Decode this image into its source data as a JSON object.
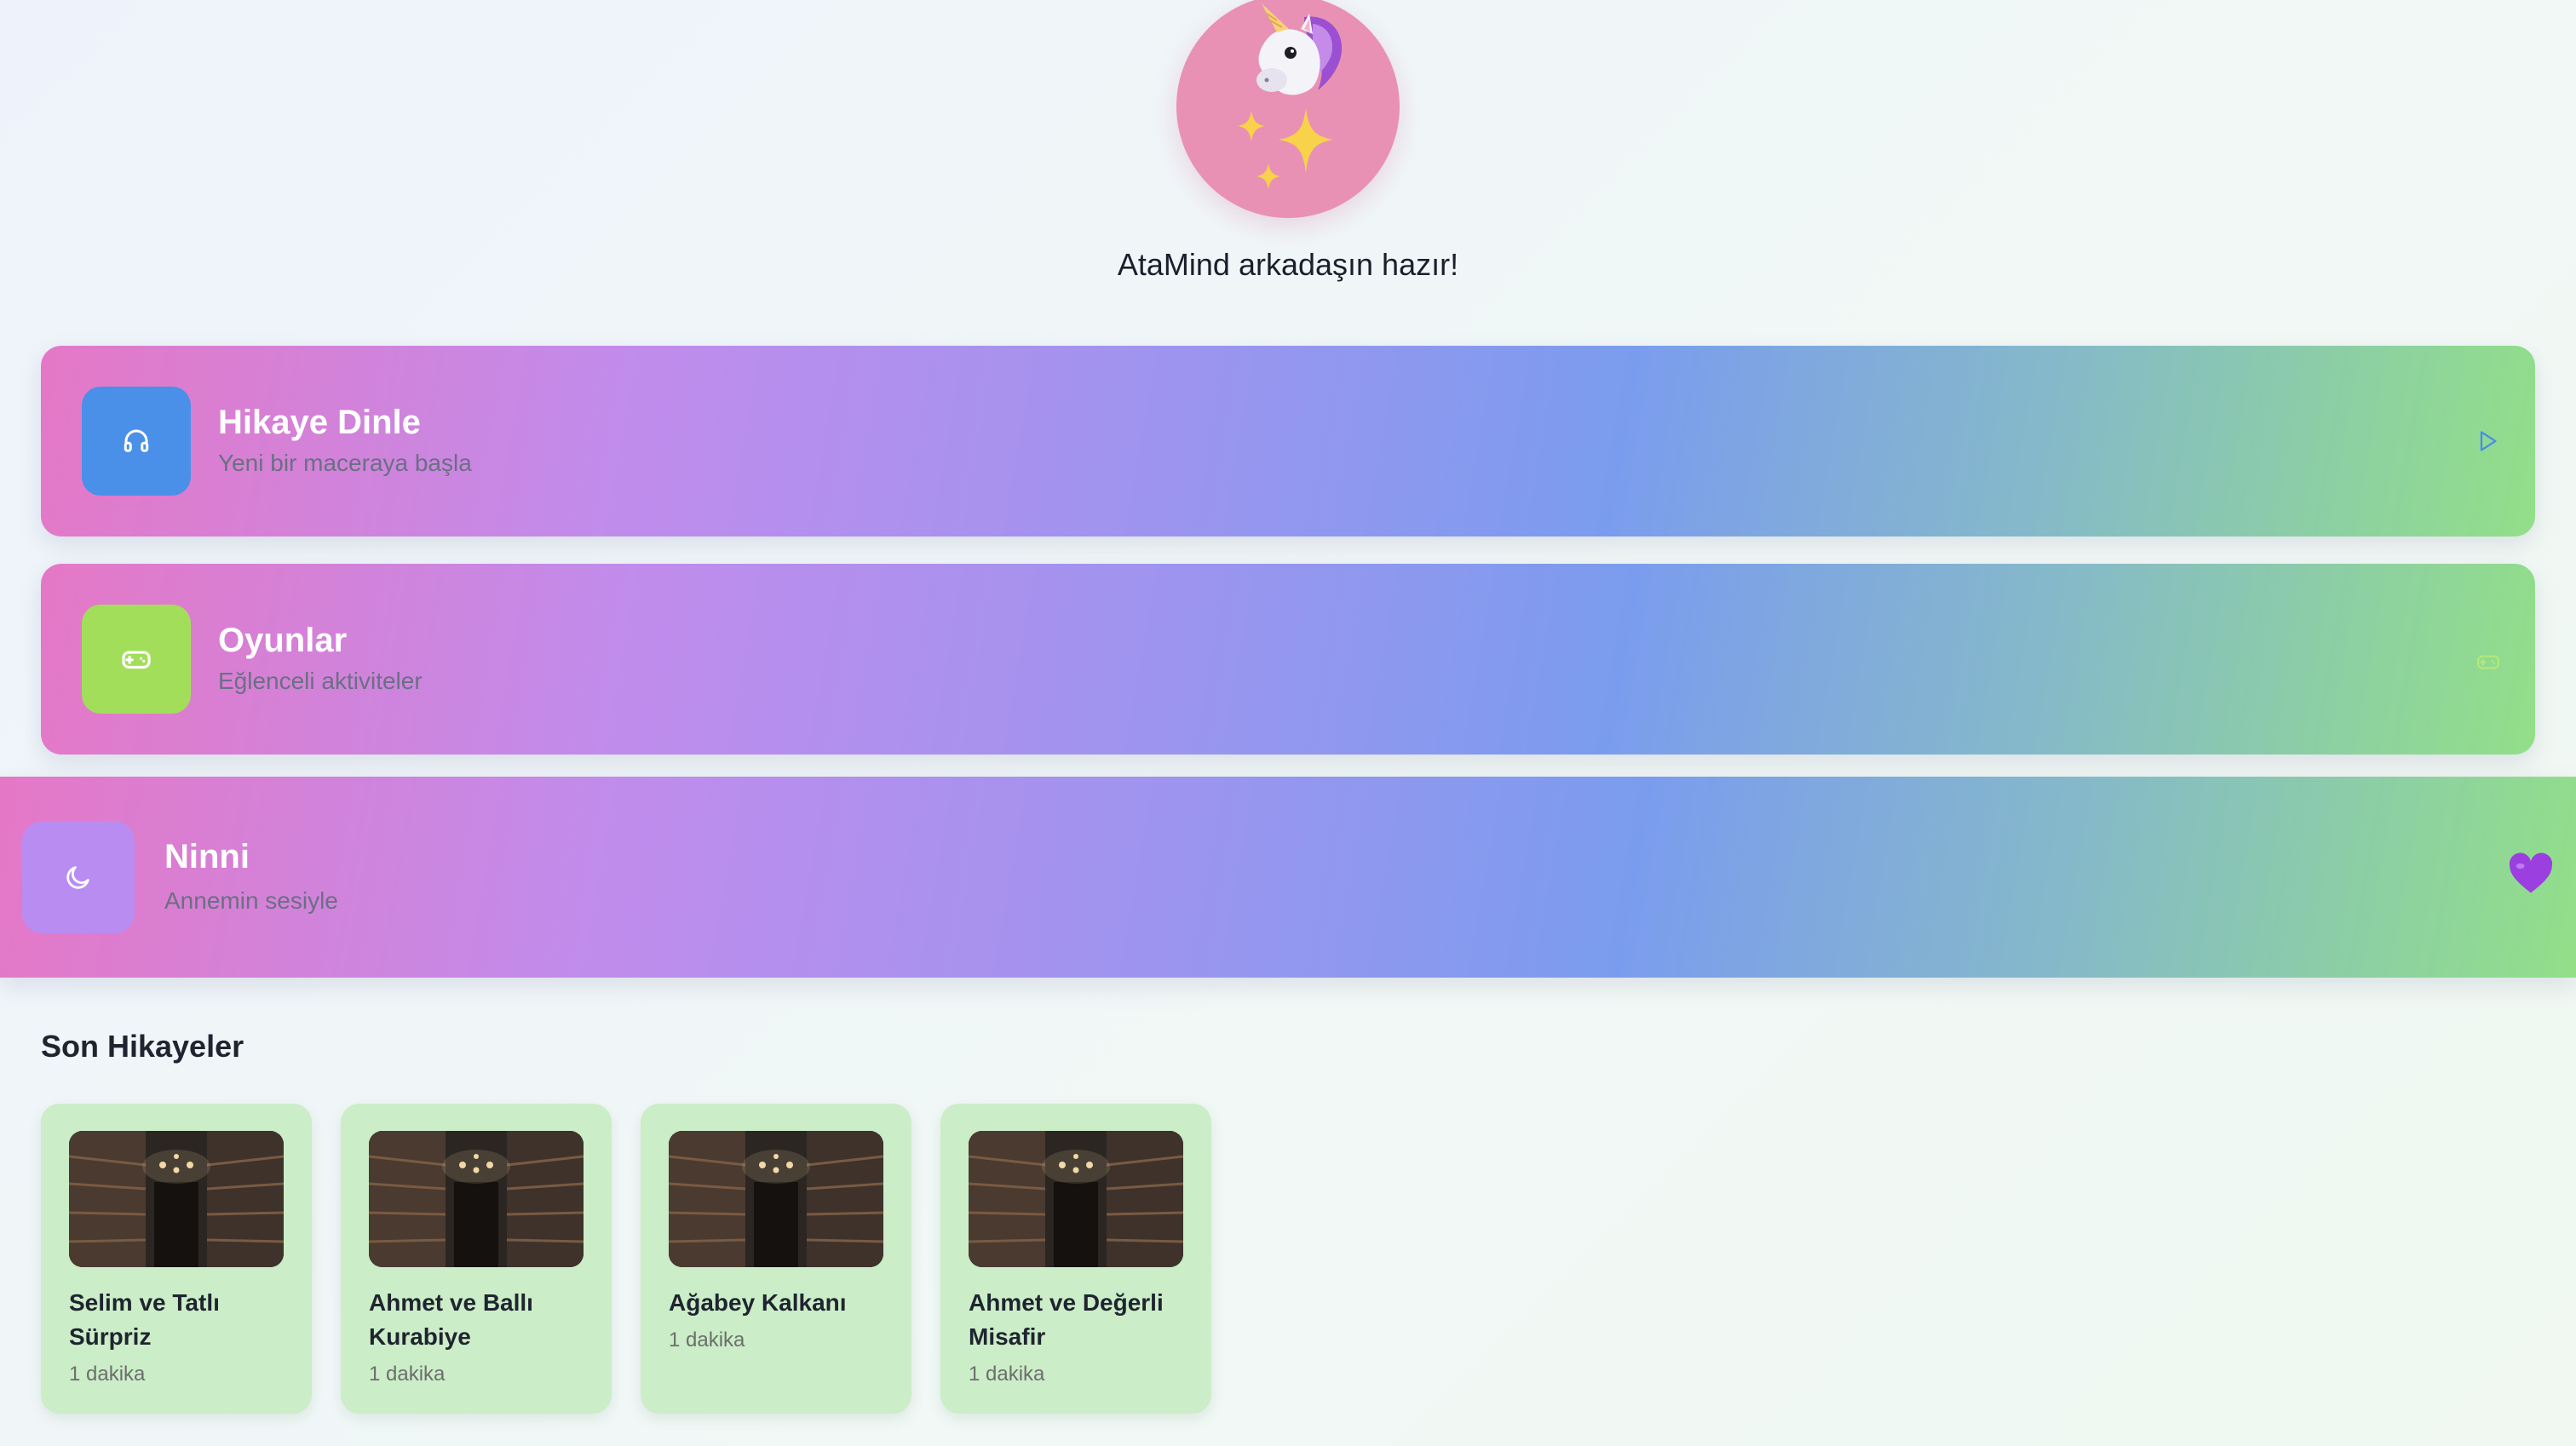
{
  "header": {
    "greeting": "AtaMind arkadaşın hazır!",
    "avatar_icon": "unicorn-sparkles"
  },
  "actions": [
    {
      "title": "Hikaye Dinle",
      "subtitle": "Yeni bir maceraya başla",
      "icon": "headphones-icon",
      "trailing_icon": "play-icon",
      "icon_bg": "#4a90e8"
    },
    {
      "title": "Oyunlar",
      "subtitle": "Eğlenceli aktiviteler",
      "icon": "gamepad-icon",
      "trailing_icon": "gamepad-icon",
      "icon_bg": "#a3de5a"
    },
    {
      "title": "Ninni",
      "subtitle": "Annemin sesiyle",
      "icon": "moon-icon",
      "trailing_icon": "purple-heart-icon",
      "icon_bg": "#b98cf2"
    }
  ],
  "recent": {
    "title": "Son Hikayeler",
    "stories": [
      {
        "title": "Selim ve Tatlı Sürpriz",
        "duration": "1 dakika"
      },
      {
        "title": "Ahmet ve Ballı Kurabiye",
        "duration": "1 dakika"
      },
      {
        "title": "Ağabey Kalkanı",
        "duration": "1 dakika"
      },
      {
        "title": "Ahmet ve Değerli Misafir",
        "duration": "1 dakika"
      }
    ]
  },
  "colors": {
    "card_gradient": [
      "#e578c6",
      "#c08cec",
      "#7b9cee",
      "#92df88"
    ],
    "story_card_bg": "#cbedc7",
    "avatar_bg": "#e891b4"
  }
}
